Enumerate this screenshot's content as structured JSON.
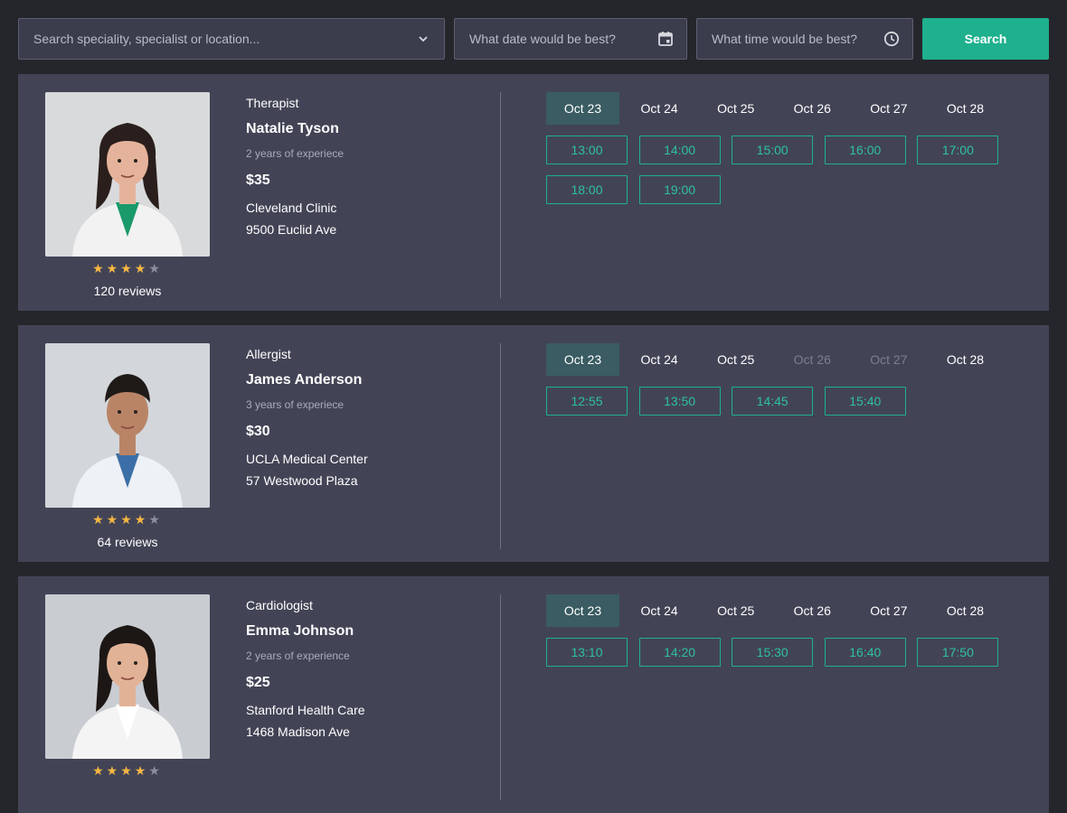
{
  "search": {
    "specialty_placeholder": "Search speciality, specialist or location...",
    "date_placeholder": "What date would be best?",
    "time_placeholder": "What time would be best?",
    "button_label": "Search"
  },
  "colors": {
    "background": "#25262b",
    "card": "#424456",
    "accent": "#1fb08e",
    "active_date": "#3a5c62",
    "star": "#f5b642"
  },
  "doctors": [
    {
      "specialty": "Therapist",
      "name": "Natalie Tyson",
      "experience": "2 years of experiece",
      "price": "$35",
      "clinic": "Cleveland Clinic",
      "address": "9500 Euclid Ave",
      "rating": 4,
      "reviews": "120 reviews",
      "dates": [
        {
          "label": "Oct 23",
          "active": true,
          "disabled": false
        },
        {
          "label": "Oct 24",
          "active": false,
          "disabled": false
        },
        {
          "label": "Oct 25",
          "active": false,
          "disabled": false
        },
        {
          "label": "Oct 26",
          "active": false,
          "disabled": false
        },
        {
          "label": "Oct 27",
          "active": false,
          "disabled": false
        },
        {
          "label": "Oct 28",
          "active": false,
          "disabled": false
        }
      ],
      "slots": [
        "13:00",
        "14:00",
        "15:00",
        "16:00",
        "17:00",
        "18:00",
        "19:00"
      ]
    },
    {
      "specialty": "Allergist",
      "name": "James Anderson",
      "experience": "3 years of experiece",
      "price": "$30",
      "clinic": "UCLA Medical Center",
      "address": "57 Westwood Plaza",
      "rating": 4,
      "reviews": "64 reviews",
      "dates": [
        {
          "label": "Oct 23",
          "active": true,
          "disabled": false
        },
        {
          "label": "Oct 24",
          "active": false,
          "disabled": false
        },
        {
          "label": "Oct 25",
          "active": false,
          "disabled": false
        },
        {
          "label": "Oct 26",
          "active": false,
          "disabled": true
        },
        {
          "label": "Oct 27",
          "active": false,
          "disabled": true
        },
        {
          "label": "Oct 28",
          "active": false,
          "disabled": false
        }
      ],
      "slots": [
        "12:55",
        "13:50",
        "14:45",
        "15:40"
      ]
    },
    {
      "specialty": "Cardiologist",
      "name": "Emma Johnson",
      "experience": "2 years of experience",
      "price": "$25",
      "clinic": "Stanford Health Care",
      "address": "1468 Madison Ave",
      "rating": 4,
      "reviews": "",
      "dates": [
        {
          "label": "Oct 23",
          "active": true,
          "disabled": false
        },
        {
          "label": "Oct 24",
          "active": false,
          "disabled": false
        },
        {
          "label": "Oct 25",
          "active": false,
          "disabled": false
        },
        {
          "label": "Oct 26",
          "active": false,
          "disabled": false
        },
        {
          "label": "Oct 27",
          "active": false,
          "disabled": false
        },
        {
          "label": "Oct 28",
          "active": false,
          "disabled": false
        }
      ],
      "slots": [
        "13:10",
        "14:20",
        "15:30",
        "16:40",
        "17:50"
      ]
    }
  ]
}
